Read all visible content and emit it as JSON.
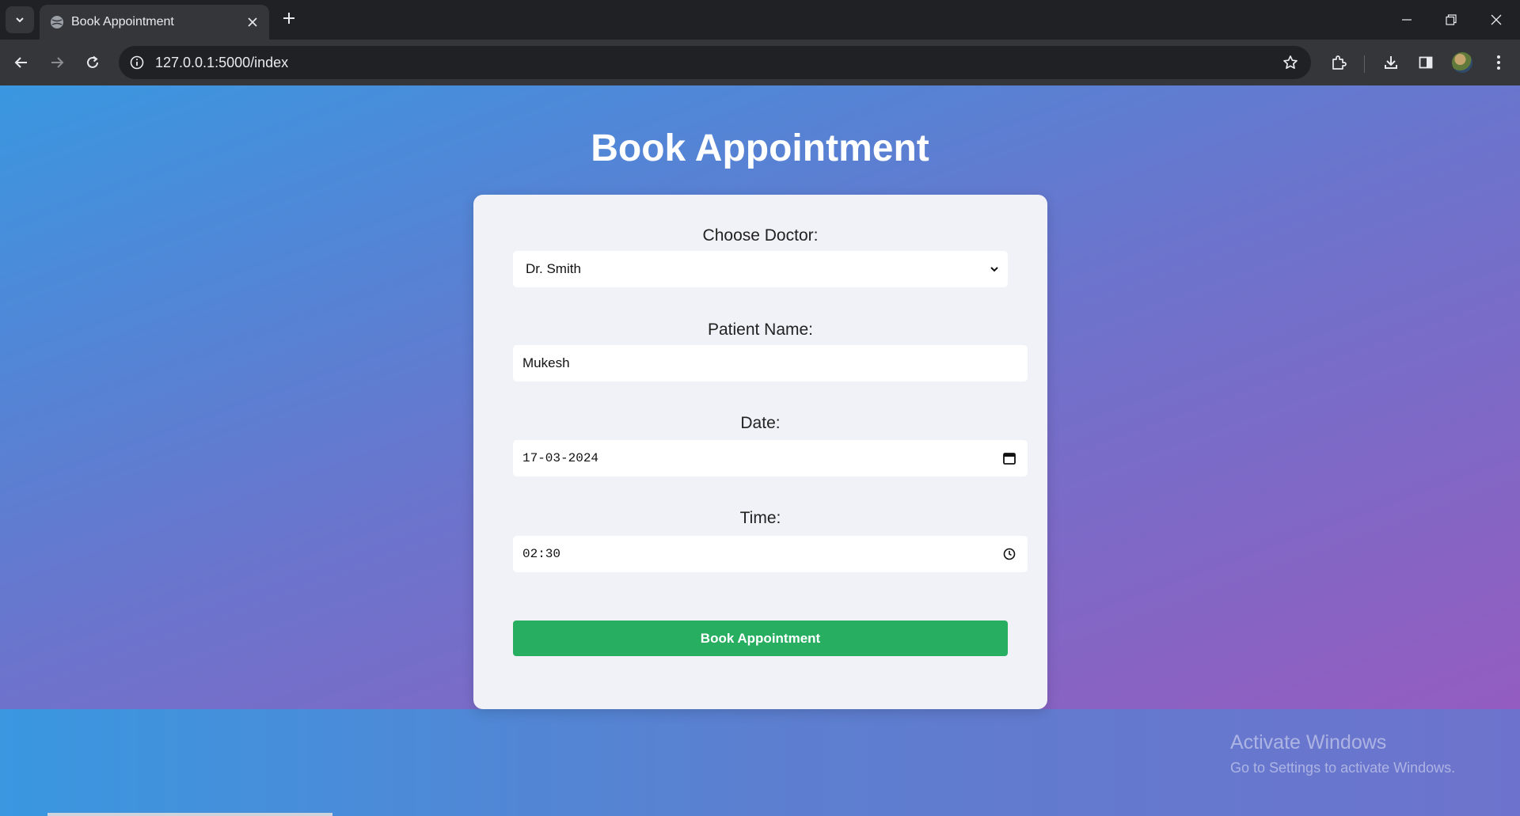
{
  "browser": {
    "tab": {
      "title": "Book Appointment"
    },
    "address_bar": {
      "url": "127.0.0.1:5000/index"
    }
  },
  "page": {
    "heading": "Book Appointment",
    "form": {
      "doctor": {
        "label": "Choose Doctor:",
        "selected": "Dr. Smith"
      },
      "patient_name": {
        "label": "Patient Name:",
        "value": "Mukesh"
      },
      "date": {
        "label": "Date:",
        "value": "17-03-2024"
      },
      "time": {
        "label": "Time:",
        "value": "02:30"
      },
      "submit_label": "Book Appointment"
    }
  },
  "os_watermark": {
    "title": "Activate Windows",
    "subtitle": "Go to Settings to activate Windows."
  },
  "colors": {
    "submit_button": "#27ae60",
    "gradient_start": "#3a97e0",
    "gradient_end": "#9b58be",
    "card_background": "#f1f1f8"
  }
}
